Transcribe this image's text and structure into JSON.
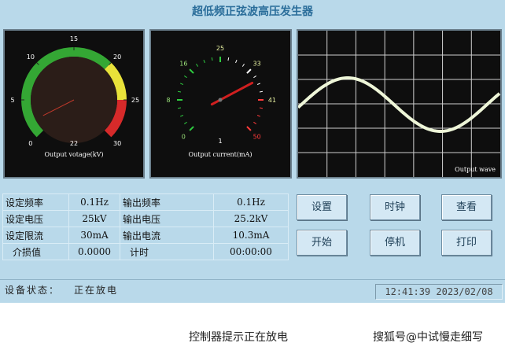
{
  "title": "超低频正弦波高压发生器",
  "voltage_gauge": {
    "caption": "Output votage(kV)",
    "ticks": [
      "0",
      "5",
      "10",
      "15",
      "20",
      "25",
      "30"
    ],
    "center_value": "22",
    "zones": [
      {
        "from": 0,
        "to": 20,
        "color": "#34a734"
      },
      {
        "from": 20,
        "to": 25,
        "color": "#e8e23a"
      },
      {
        "from": 25,
        "to": 30,
        "color": "#d62a2a"
      }
    ],
    "needle_color": "#c0392b"
  },
  "current_gauge": {
    "caption": "Output current(mA)",
    "ticks": [
      "0",
      "8",
      "16",
      "25",
      "33",
      "41",
      "50"
    ],
    "center_value": "1",
    "tick_colors": {
      "low": "#2ecc40",
      "high": "#ff3b3b"
    },
    "needle_color": "#d01f1f"
  },
  "waveform": {
    "label": "Output wave",
    "line_color": "#eef6d8",
    "grid_color": "#cfcfcf"
  },
  "params": {
    "set_freq_label": "设定频率",
    "set_freq_value": "0.1Hz",
    "out_freq_label": "输出频率",
    "out_freq_value": "0.1Hz",
    "set_volt_label": "设定电压",
    "set_volt_value": "25kV",
    "out_volt_label": "输出电压",
    "out_volt_value": "25.2kV",
    "set_curr_label": "设定限流",
    "set_curr_value": "30mA",
    "out_curr_label": "输出电流",
    "out_curr_value": "10.3mA",
    "loss_label": "介损值",
    "loss_value": "0.0000",
    "timer_label": "计时",
    "timer_value": "00:00:00"
  },
  "buttons": {
    "settings": "设置",
    "clock": "时钟",
    "view": "查看",
    "start": "开始",
    "stop": "停机",
    "print": "打印"
  },
  "status": {
    "label": "设备状态：",
    "value": "正在放电",
    "clock": "12:41:39 2023/02/08"
  },
  "footer": {
    "hint": "控制器提示正在放电",
    "watermark": "搜狐号@中试慢走细写"
  }
}
